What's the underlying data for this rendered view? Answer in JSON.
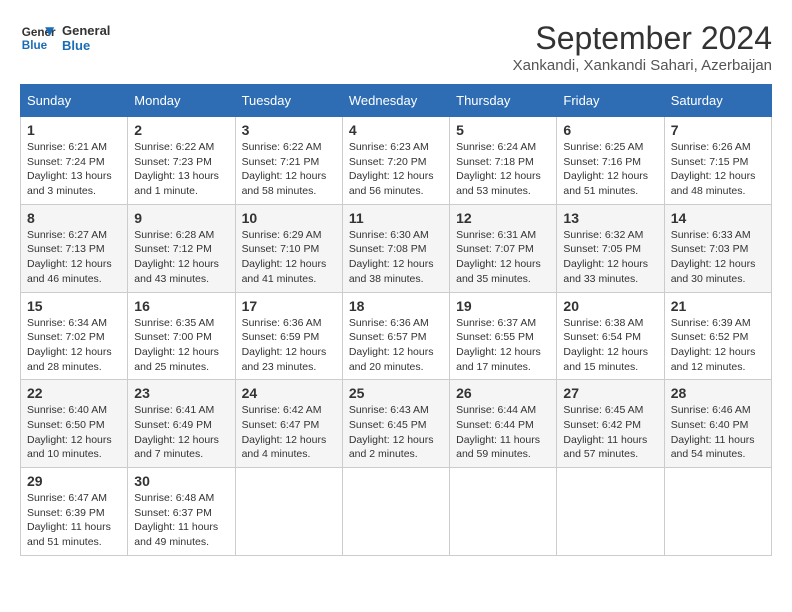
{
  "header": {
    "logo": {
      "line1": "General",
      "line2": "Blue"
    },
    "title": "September 2024",
    "subtitle": "Xankandi, Xankandi Sahari, Azerbaijan"
  },
  "weekdays": [
    "Sunday",
    "Monday",
    "Tuesday",
    "Wednesday",
    "Thursday",
    "Friday",
    "Saturday"
  ],
  "weeks": [
    [
      {
        "day": "1",
        "sunrise": "6:21 AM",
        "sunset": "7:24 PM",
        "daylight": "13 hours and 3 minutes."
      },
      {
        "day": "2",
        "sunrise": "6:22 AM",
        "sunset": "7:23 PM",
        "daylight": "13 hours and 1 minute."
      },
      {
        "day": "3",
        "sunrise": "6:22 AM",
        "sunset": "7:21 PM",
        "daylight": "12 hours and 58 minutes."
      },
      {
        "day": "4",
        "sunrise": "6:23 AM",
        "sunset": "7:20 PM",
        "daylight": "12 hours and 56 minutes."
      },
      {
        "day": "5",
        "sunrise": "6:24 AM",
        "sunset": "7:18 PM",
        "daylight": "12 hours and 53 minutes."
      },
      {
        "day": "6",
        "sunrise": "6:25 AM",
        "sunset": "7:16 PM",
        "daylight": "12 hours and 51 minutes."
      },
      {
        "day": "7",
        "sunrise": "6:26 AM",
        "sunset": "7:15 PM",
        "daylight": "12 hours and 48 minutes."
      }
    ],
    [
      {
        "day": "8",
        "sunrise": "6:27 AM",
        "sunset": "7:13 PM",
        "daylight": "12 hours and 46 minutes."
      },
      {
        "day": "9",
        "sunrise": "6:28 AM",
        "sunset": "7:12 PM",
        "daylight": "12 hours and 43 minutes."
      },
      {
        "day": "10",
        "sunrise": "6:29 AM",
        "sunset": "7:10 PM",
        "daylight": "12 hours and 41 minutes."
      },
      {
        "day": "11",
        "sunrise": "6:30 AM",
        "sunset": "7:08 PM",
        "daylight": "12 hours and 38 minutes."
      },
      {
        "day": "12",
        "sunrise": "6:31 AM",
        "sunset": "7:07 PM",
        "daylight": "12 hours and 35 minutes."
      },
      {
        "day": "13",
        "sunrise": "6:32 AM",
        "sunset": "7:05 PM",
        "daylight": "12 hours and 33 minutes."
      },
      {
        "day": "14",
        "sunrise": "6:33 AM",
        "sunset": "7:03 PM",
        "daylight": "12 hours and 30 minutes."
      }
    ],
    [
      {
        "day": "15",
        "sunrise": "6:34 AM",
        "sunset": "7:02 PM",
        "daylight": "12 hours and 28 minutes."
      },
      {
        "day": "16",
        "sunrise": "6:35 AM",
        "sunset": "7:00 PM",
        "daylight": "12 hours and 25 minutes."
      },
      {
        "day": "17",
        "sunrise": "6:36 AM",
        "sunset": "6:59 PM",
        "daylight": "12 hours and 23 minutes."
      },
      {
        "day": "18",
        "sunrise": "6:36 AM",
        "sunset": "6:57 PM",
        "daylight": "12 hours and 20 minutes."
      },
      {
        "day": "19",
        "sunrise": "6:37 AM",
        "sunset": "6:55 PM",
        "daylight": "12 hours and 17 minutes."
      },
      {
        "day": "20",
        "sunrise": "6:38 AM",
        "sunset": "6:54 PM",
        "daylight": "12 hours and 15 minutes."
      },
      {
        "day": "21",
        "sunrise": "6:39 AM",
        "sunset": "6:52 PM",
        "daylight": "12 hours and 12 minutes."
      }
    ],
    [
      {
        "day": "22",
        "sunrise": "6:40 AM",
        "sunset": "6:50 PM",
        "daylight": "12 hours and 10 minutes."
      },
      {
        "day": "23",
        "sunrise": "6:41 AM",
        "sunset": "6:49 PM",
        "daylight": "12 hours and 7 minutes."
      },
      {
        "day": "24",
        "sunrise": "6:42 AM",
        "sunset": "6:47 PM",
        "daylight": "12 hours and 4 minutes."
      },
      {
        "day": "25",
        "sunrise": "6:43 AM",
        "sunset": "6:45 PM",
        "daylight": "12 hours and 2 minutes."
      },
      {
        "day": "26",
        "sunrise": "6:44 AM",
        "sunset": "6:44 PM",
        "daylight": "11 hours and 59 minutes."
      },
      {
        "day": "27",
        "sunrise": "6:45 AM",
        "sunset": "6:42 PM",
        "daylight": "11 hours and 57 minutes."
      },
      {
        "day": "28",
        "sunrise": "6:46 AM",
        "sunset": "6:40 PM",
        "daylight": "11 hours and 54 minutes."
      }
    ],
    [
      {
        "day": "29",
        "sunrise": "6:47 AM",
        "sunset": "6:39 PM",
        "daylight": "11 hours and 51 minutes."
      },
      {
        "day": "30",
        "sunrise": "6:48 AM",
        "sunset": "6:37 PM",
        "daylight": "11 hours and 49 minutes."
      },
      null,
      null,
      null,
      null,
      null
    ]
  ]
}
